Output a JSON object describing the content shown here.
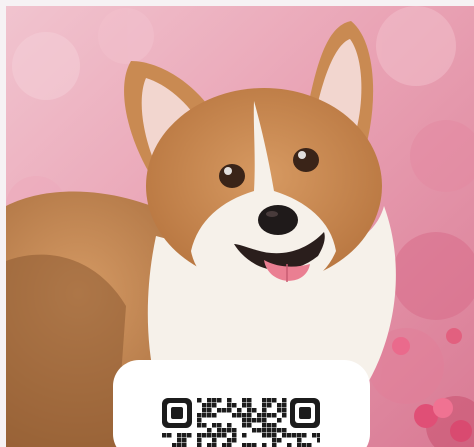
{
  "photo": {
    "subject": "corgi-photo",
    "colors": {
      "background_pink": "#e79aae",
      "fur_tan": "#c8894f",
      "fur_white": "#f6f1ea",
      "nose": "#1f1a1a",
      "tongue": "#ea7f92"
    }
  },
  "qr": {
    "icon": "qr-code-icon",
    "colors": {
      "card": "#ffffff",
      "modules": "#1c1c1c"
    }
  }
}
